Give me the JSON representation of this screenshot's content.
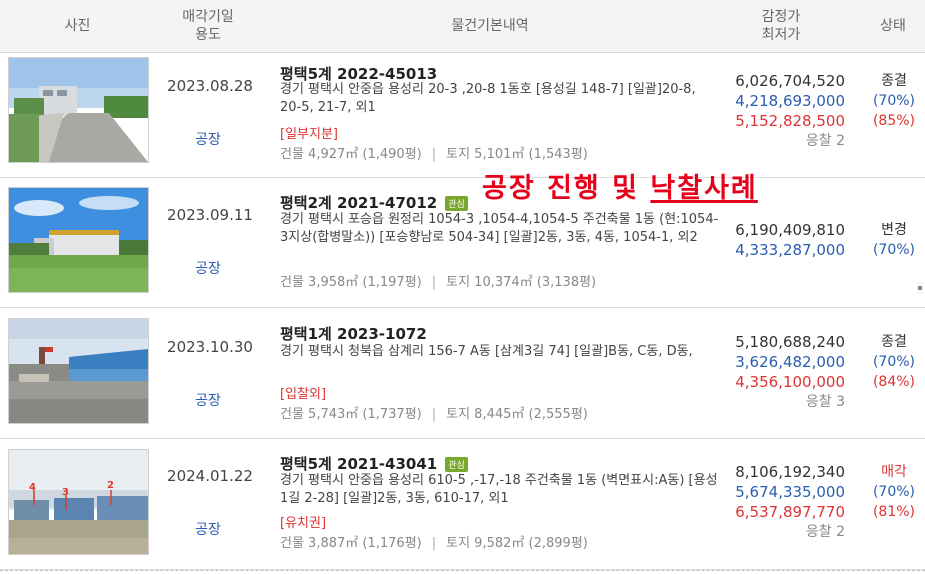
{
  "header": {
    "photo": "사진",
    "date_line1": "매각기일",
    "date_line2": "용도",
    "info": "물건기본내역",
    "price_line1": "감정가",
    "price_line2": "최저가",
    "status": "상태"
  },
  "overlay": {
    "title_plain": "공장 진행 및 ",
    "title_underlined": "낙찰사례"
  },
  "rows": [
    {
      "date": "2023.08.28",
      "usage": "공장",
      "case": "평택5계 2022-45013",
      "badge": "",
      "address": "경기 평택시 안중읍 용성리 20-3 ,20-8 1동호 [용성길 148-7] [일괄]20-8, 20-5, 21-7, 외1",
      "note": "[일부지분]",
      "building": "건물 4,927㎡ (1,490평)",
      "land": "토지 5,101㎡ (1,543평)",
      "appraisal": "6,026,704,520",
      "minimum": "4,218,693,000",
      "sold": "5,152,828,500",
      "bids": "응찰 2",
      "status": "종결",
      "min_pct": "(70%)",
      "sold_pct": "(85%)"
    },
    {
      "date": "2023.09.11",
      "usage": "공장",
      "case": "평택2계 2021-47012",
      "badge": "관심",
      "address": "경기 평택시 포승읍 원정리 1054-3 ,1054-4,1054-5 주건축물 1동 (현:1054-3지상(합병말소)) [포승향남로 504-34] [일괄]2동, 3동, 4동, 1054-1, 외2",
      "note": "",
      "building": "건물 3,958㎡ (1,197평)",
      "land": "토지 10,374㎡ (3,138평)",
      "appraisal": "6,190,409,810",
      "minimum": "4,333,287,000",
      "sold": "",
      "bids": "",
      "status": "변경",
      "min_pct": "(70%)",
      "sold_pct": ""
    },
    {
      "date": "2023.10.30",
      "usage": "공장",
      "case": "평택1계 2023-1072",
      "badge": "",
      "address": "경기 평택시 청북읍 삼계리 156-7 A동 [삼계3길 74] [일괄]B동, C동, D동,",
      "note": "[입찰외]",
      "building": "건물 5,743㎡ (1,737평)",
      "land": "토지 8,445㎡ (2,555평)",
      "appraisal": "5,180,688,240",
      "minimum": "3,626,482,000",
      "sold": "4,356,100,000",
      "bids": "응찰 3",
      "status": "종결",
      "min_pct": "(70%)",
      "sold_pct": "(84%)"
    },
    {
      "date": "2024.01.22",
      "usage": "공장",
      "case": "평택5계 2021-43041",
      "badge": "관심",
      "address": "경기 평택시 안중읍 용성리 610-5 ,-17,-18 주건축물 1동 (벽면표시:A동) [용성1길 2-28] [일괄]2동, 3동, 610-17, 외1",
      "note": "[유치권]",
      "building": "건물 3,887㎡ (1,176평)",
      "land": "토지 9,582㎡ (2,899평)",
      "appraisal": "8,106,192,340",
      "minimum": "5,674,335,000",
      "sold": "6,537,897,770",
      "bids": "응찰 2",
      "status": "매각",
      "min_pct": "(70%)",
      "sold_pct": "(81%)"
    }
  ],
  "photo_labels": [
    "4",
    "3",
    "2"
  ]
}
